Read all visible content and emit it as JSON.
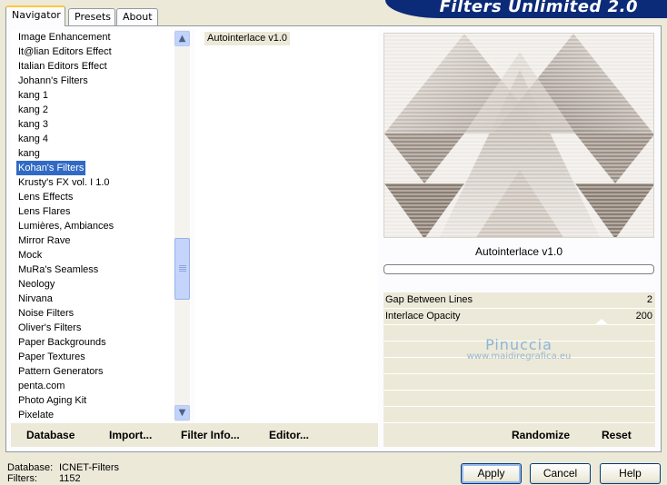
{
  "tabs": [
    {
      "label": "Navigator",
      "active": true
    },
    {
      "label": "Presets",
      "active": false
    },
    {
      "label": "About",
      "active": false
    }
  ],
  "brand": {
    "title": "Filters Unlimited 2.0"
  },
  "categories": {
    "items": [
      "Image Enhancement",
      "It@lian Editors Effect",
      "Italian Editors Effect",
      "Johann's Filters",
      "kang 1",
      "kang 2",
      "kang 3",
      "kang 4",
      "kang",
      "Kohan's Filters",
      "Krusty's FX vol. I 1.0",
      "Lens Effects",
      "Lens Flares",
      "Lumières, Ambiances",
      "Mirror Rave",
      "Mock",
      "MuRa's Seamless",
      "Neology",
      "Nirvana",
      "Noise Filters",
      "Oliver's Filters",
      "Paper Backgrounds",
      "Paper Textures",
      "Pattern Generators",
      "penta.com",
      "Photo Aging Kit",
      "Pixelate"
    ],
    "selected": "Kohan's Filters"
  },
  "filters": {
    "items": [
      "Autointerlace v1.0"
    ],
    "selected": "Autointerlace v1.0"
  },
  "preview": {
    "filter_name": "Autointerlace v1.0",
    "progress": 0
  },
  "params": [
    {
      "label": "Gap Between Lines",
      "value": "2",
      "level": 0.02
    },
    {
      "label": "Interlace Opacity",
      "value": "200",
      "level": 0.78
    }
  ],
  "watermark": {
    "name": "Pinuccia",
    "url": "www.maidiregrafica.eu"
  },
  "toolbar": {
    "database": "Database",
    "import": "Import...",
    "filter_info": "Filter Info...",
    "editor": "Editor...",
    "randomize": "Randomize",
    "reset": "Reset"
  },
  "info": {
    "database_label": "Database:",
    "database_value": "ICNET-Filters",
    "filters_label": "Filters:",
    "filters_value": "1152"
  },
  "buttons": {
    "apply": "Apply",
    "cancel": "Cancel",
    "help": "Help"
  },
  "colors": {
    "brand_bg": "#0b2a78",
    "selection": "#316ac5",
    "window_bg": "#ece9d8"
  }
}
